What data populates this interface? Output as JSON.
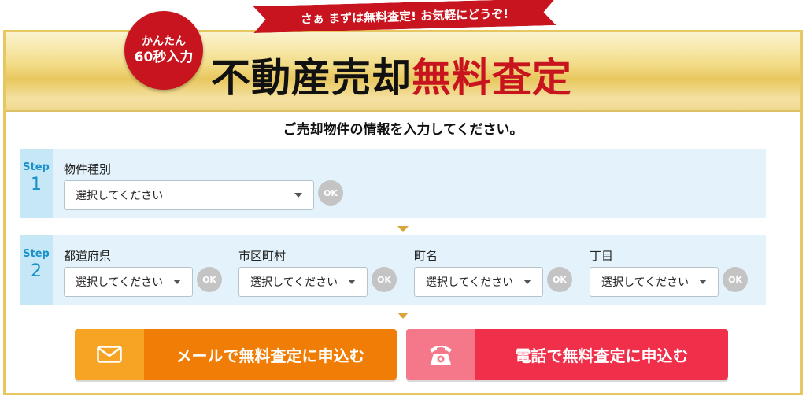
{
  "header": {
    "ribbon_text": "さぁ まずは無料査定! お気軽にどうぞ!",
    "badge_line1": "かんたん",
    "badge_line2": "60秒入力",
    "title_black": "不動産売却",
    "title_red": "無料査定"
  },
  "subtitle": "ご売却物件の情報を入力してください。",
  "step1": {
    "step_word": "Step",
    "step_num": "1",
    "field_label": "物件種別",
    "select_value": "選択してください",
    "ok_label": "OK"
  },
  "step2": {
    "step_word": "Step",
    "step_num": "2",
    "fields": [
      {
        "label": "都道府県",
        "select_value": "選択してください",
        "ok_label": "OK"
      },
      {
        "label": "市区町村",
        "select_value": "選択してください",
        "ok_label": "OK"
      },
      {
        "label": "町名",
        "select_value": "選択してください",
        "ok_label": "OK"
      },
      {
        "label": "丁目",
        "select_value": "選択してください",
        "ok_label": "OK"
      }
    ]
  },
  "actions": {
    "mail_label": "メールで無料査定に申込む",
    "tel_label": "電話で無料査定に申込む"
  },
  "icons": {
    "mail": "mail-icon",
    "tel": "phone-icon",
    "caret": "chevron-down-icon"
  },
  "colors": {
    "brand_red": "#c8141e",
    "gold": "#e6c760",
    "step_bg": "#e4f3fb",
    "step_accent": "#1a92c9",
    "mail_orange": "#f07e06",
    "tel_red": "#f0304a"
  }
}
